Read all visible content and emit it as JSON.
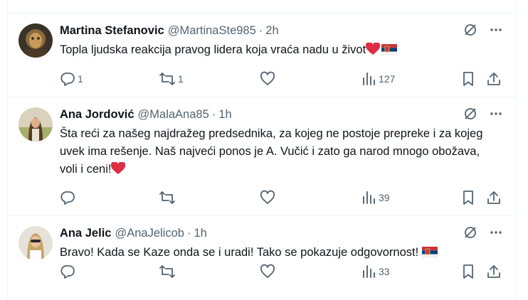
{
  "tweets": [
    {
      "name": "Martina Stefanovic",
      "handle": "@MartinaSte985",
      "time": "2h",
      "text": "Topla ljudska reakcija pravog lidera koja vraća nadu u život",
      "text_emojis": [
        "red-heart",
        "serbia-flag"
      ],
      "replies": "1",
      "reposts": "1",
      "likes": "",
      "views": "127"
    },
    {
      "name": "Ana Jordović",
      "handle": "@MalaAna85",
      "time": "1h",
      "text": "Šta reći za našeg najdražeg predsednika, za kojeg ne postoje prepreke i za kojeg uvek ima rešenje. Naš najveći ponos je A. Vučić i zato ga narod mnogo obožava, voli i ceni!",
      "text_emojis": [
        "red-heart"
      ],
      "replies": "",
      "reposts": "",
      "likes": "",
      "views": "39"
    },
    {
      "name": "Ana Jelic",
      "handle": "@AnaJelicob",
      "time": "1h",
      "text": "Bravo! Kada se Kaze onda se i uradi! Tako se pokazuje odgovornost!",
      "text_emojis": [
        "serbia-flag"
      ],
      "replies": "",
      "reposts": "",
      "likes": "",
      "views": "33"
    }
  ],
  "colors": {
    "text": "#0f1419",
    "secondary": "#536471",
    "border": "#eff3f4",
    "heart": "#e0245e"
  },
  "icons": [
    "grok-icon",
    "more-icon",
    "reply-icon",
    "repost-icon",
    "like-icon",
    "views-icon",
    "bookmark-icon",
    "share-icon"
  ]
}
